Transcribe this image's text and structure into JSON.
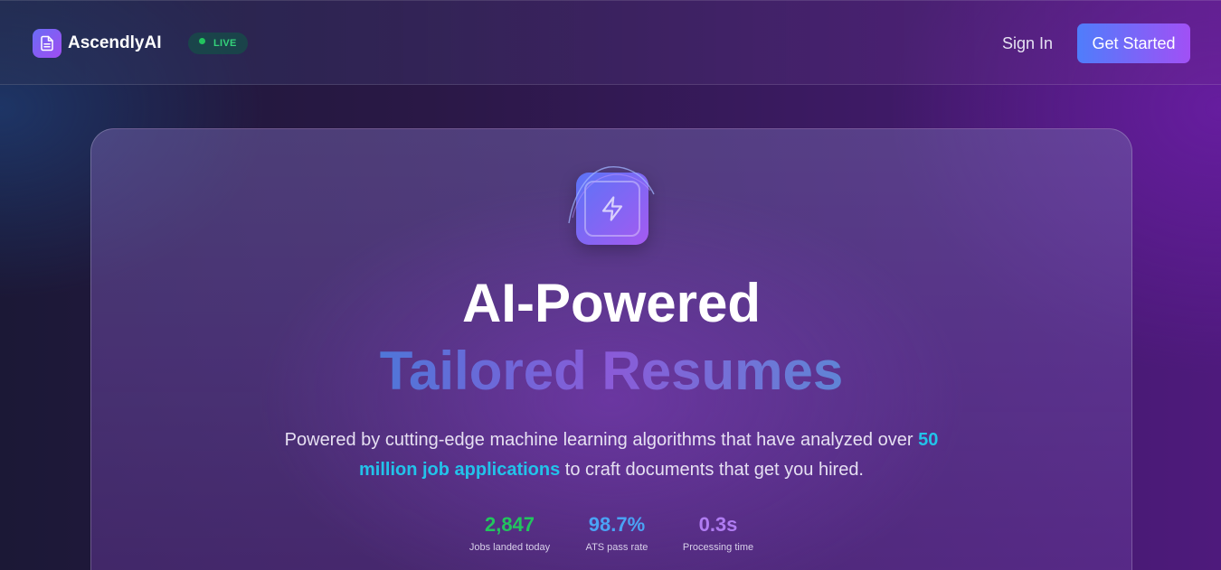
{
  "header": {
    "brand_name": "AscendlyAI",
    "brand_icon": "document-icon",
    "live_badge": "LIVE",
    "sign_in_label": "Sign In",
    "get_started_label": "Get Started"
  },
  "hero": {
    "icon": "lightning-icon",
    "title_line1": "AI-Powered",
    "title_line2": "Tailored Resumes",
    "subtitle_before": "Powered by cutting-edge machine learning algorithms that have analyzed over ",
    "subtitle_highlight": "50 million job applications",
    "subtitle_after": " to craft documents that get you hired.",
    "stats": [
      {
        "value": "2,847",
        "label": "Jobs landed today",
        "color": "#22c55e"
      },
      {
        "value": "98.7%",
        "label": "ATS pass rate",
        "color": "#4aa3f5"
      },
      {
        "value": "0.3s",
        "label": "Processing time",
        "color": "#b07cf2"
      }
    ]
  },
  "colors": {
    "accent_blue": "#4f7dfb",
    "accent_purple": "#a150f5",
    "live_green": "#22c55e",
    "highlight_cyan": "#22c3ea"
  }
}
